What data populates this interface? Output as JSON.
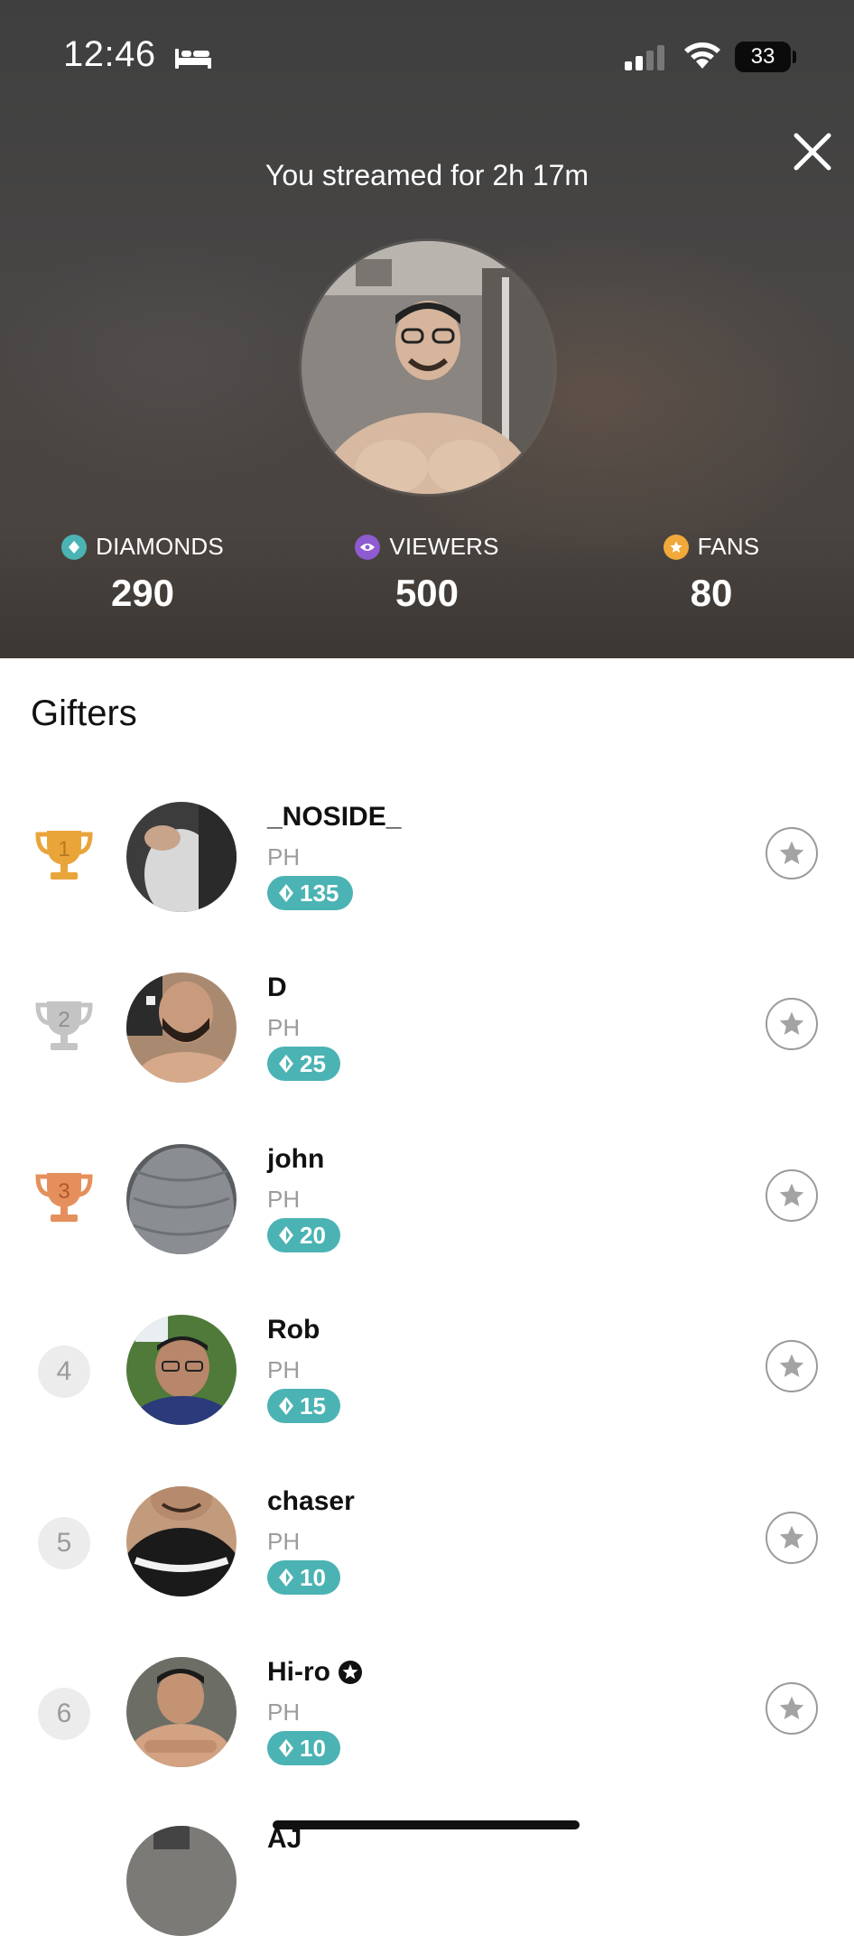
{
  "status_bar": {
    "time": "12:46",
    "battery": "33"
  },
  "header": {
    "streamed_text": "You streamed for 2h 17m",
    "stats": [
      {
        "label": "DIAMONDS",
        "value": "290",
        "color": "#4bb3b3"
      },
      {
        "label": "VIEWERS",
        "value": "500",
        "color": "#8e5bd0"
      },
      {
        "label": "FANS",
        "value": "80",
        "color": "#f0a93a"
      }
    ]
  },
  "gifters": {
    "title": "Gifters",
    "items": [
      {
        "rank": "1",
        "name": "_NOSIDE_",
        "country": "PH",
        "diamonds": "135",
        "trophy_color": "#e9a53a",
        "verified": false
      },
      {
        "rank": "2",
        "name": "D",
        "country": "PH",
        "diamonds": "25",
        "trophy_color": "#bdbdbd",
        "verified": false
      },
      {
        "rank": "3",
        "name": "john",
        "country": "PH",
        "diamonds": "20",
        "trophy_color": "#e08a55",
        "verified": false
      },
      {
        "rank": "4",
        "name": "Rob",
        "country": "PH",
        "diamonds": "15",
        "verified": false
      },
      {
        "rank": "5",
        "name": "chaser",
        "country": "PH",
        "diamonds": "10",
        "verified": false
      },
      {
        "rank": "6",
        "name": "Hi-ro",
        "country": "PH",
        "diamonds": "10",
        "verified": true
      }
    ],
    "partial_next_name": "AJ"
  }
}
